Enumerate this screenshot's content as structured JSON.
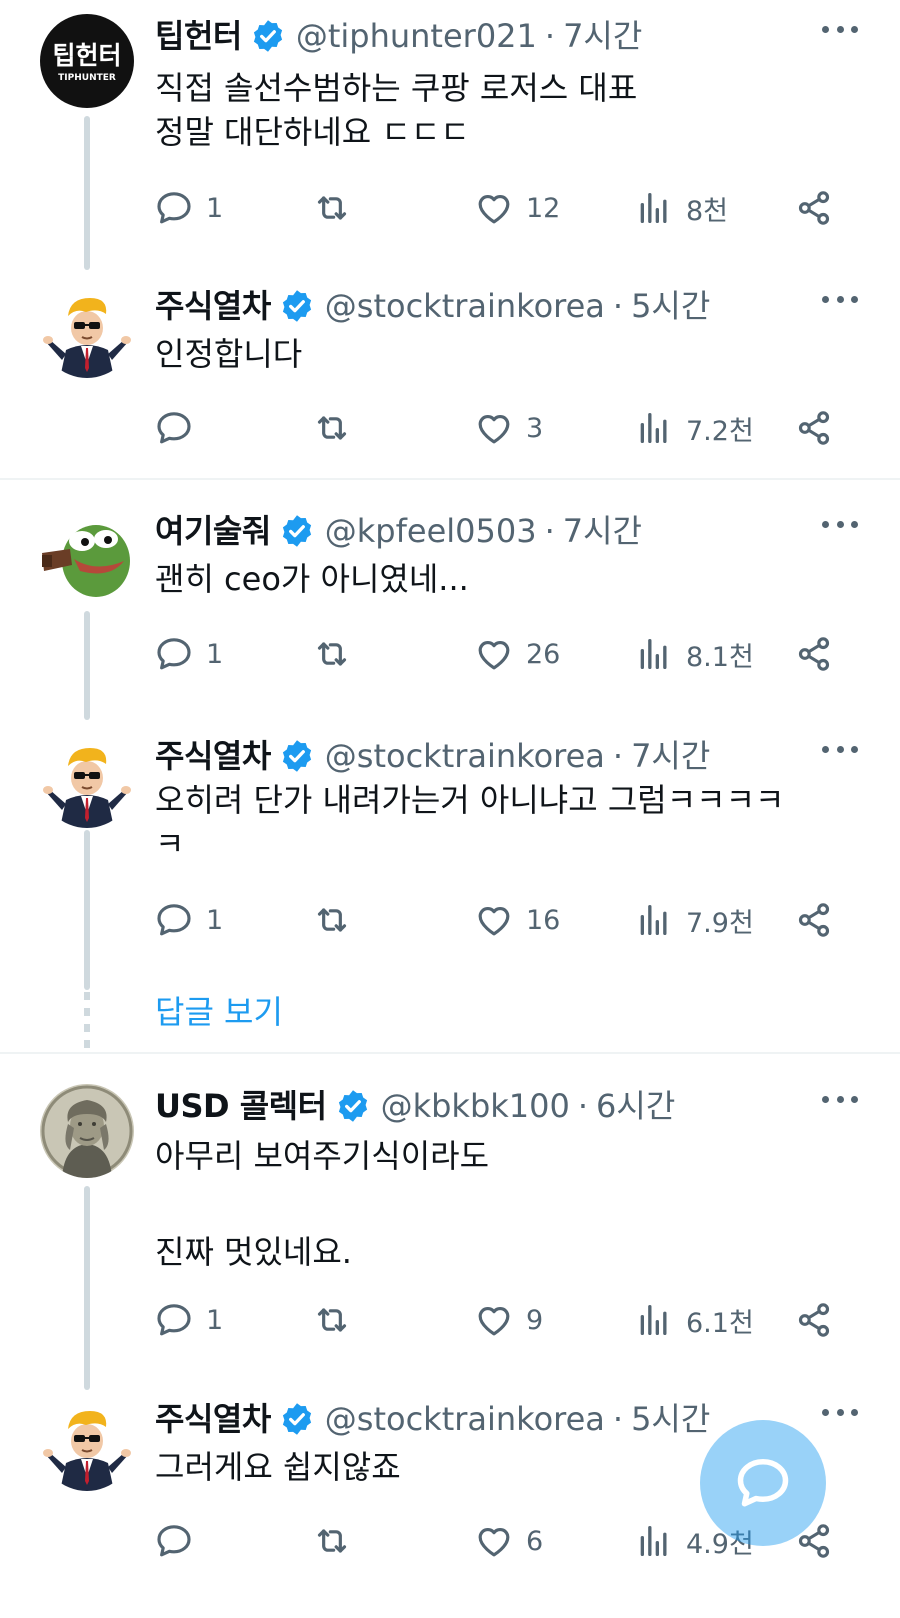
{
  "tweets": [
    {
      "name": "팁헌터",
      "handle": "@tiphunter021",
      "separator": "·",
      "time": "7시간",
      "avatar_text_main": "팁헌터",
      "avatar_text_sub": "TIPHUNTER",
      "text": "직접 솔선수범하는 쿠팡 로저스 대표\n정말 대단하네요 ㄷㄷㄷ",
      "replies": "1",
      "retweets": "",
      "likes": "12",
      "views": "8천"
    },
    {
      "name": "주식열차",
      "handle": "@stocktrainkorea",
      "separator": "·",
      "time": "5시간",
      "text": "인정합니다",
      "replies": "",
      "retweets": "",
      "likes": "3",
      "views": "7.2천"
    },
    {
      "name": "여기술줘",
      "handle": "@kpfeel0503",
      "separator": "·",
      "time": "7시간",
      "text": "괜히 ceo가 아니였네...",
      "replies": "1",
      "retweets": "",
      "likes": "26",
      "views": "8.1천"
    },
    {
      "name": "주식열차",
      "handle": "@stocktrainkorea",
      "separator": "·",
      "time": "7시간",
      "text": "오히려 단가 내려가는거 아니냐고 그럼ㅋㅋㅋㅋ\nㅋ",
      "replies": "1",
      "retweets": "",
      "likes": "16",
      "views": "7.9천"
    },
    {
      "name": "USD 콜렉터",
      "handle": "@kbkbk100",
      "separator": "·",
      "time": "6시간",
      "text": "아무리 보여주기식이라도\n\n진짜 멋있네요.",
      "replies": "1",
      "retweets": "",
      "likes": "9",
      "views": "6.1천"
    },
    {
      "name": "주식열차",
      "handle": "@stocktrainkorea",
      "separator": "·",
      "time": "5시간",
      "text": "그러게요 쉽지않죠",
      "replies": "",
      "retweets": "",
      "likes": "6",
      "views": "4.9천"
    }
  ],
  "show_replies_label": "답글 보기",
  "colors": {
    "accent": "#1d9bf0",
    "text_primary": "#0f1419",
    "text_secondary": "#536471",
    "thread_line": "#cfd9de",
    "divider": "#eff3f4"
  },
  "icons": {
    "reply": "speech-bubble-icon",
    "retweet": "retweet-arrows-icon",
    "like": "heart-icon",
    "views": "bar-chart-icon",
    "share": "share-nodes-icon",
    "more": "more-dots-icon",
    "verified": "verified-badge-icon",
    "compose_reply": "reply-bubble-icon"
  }
}
